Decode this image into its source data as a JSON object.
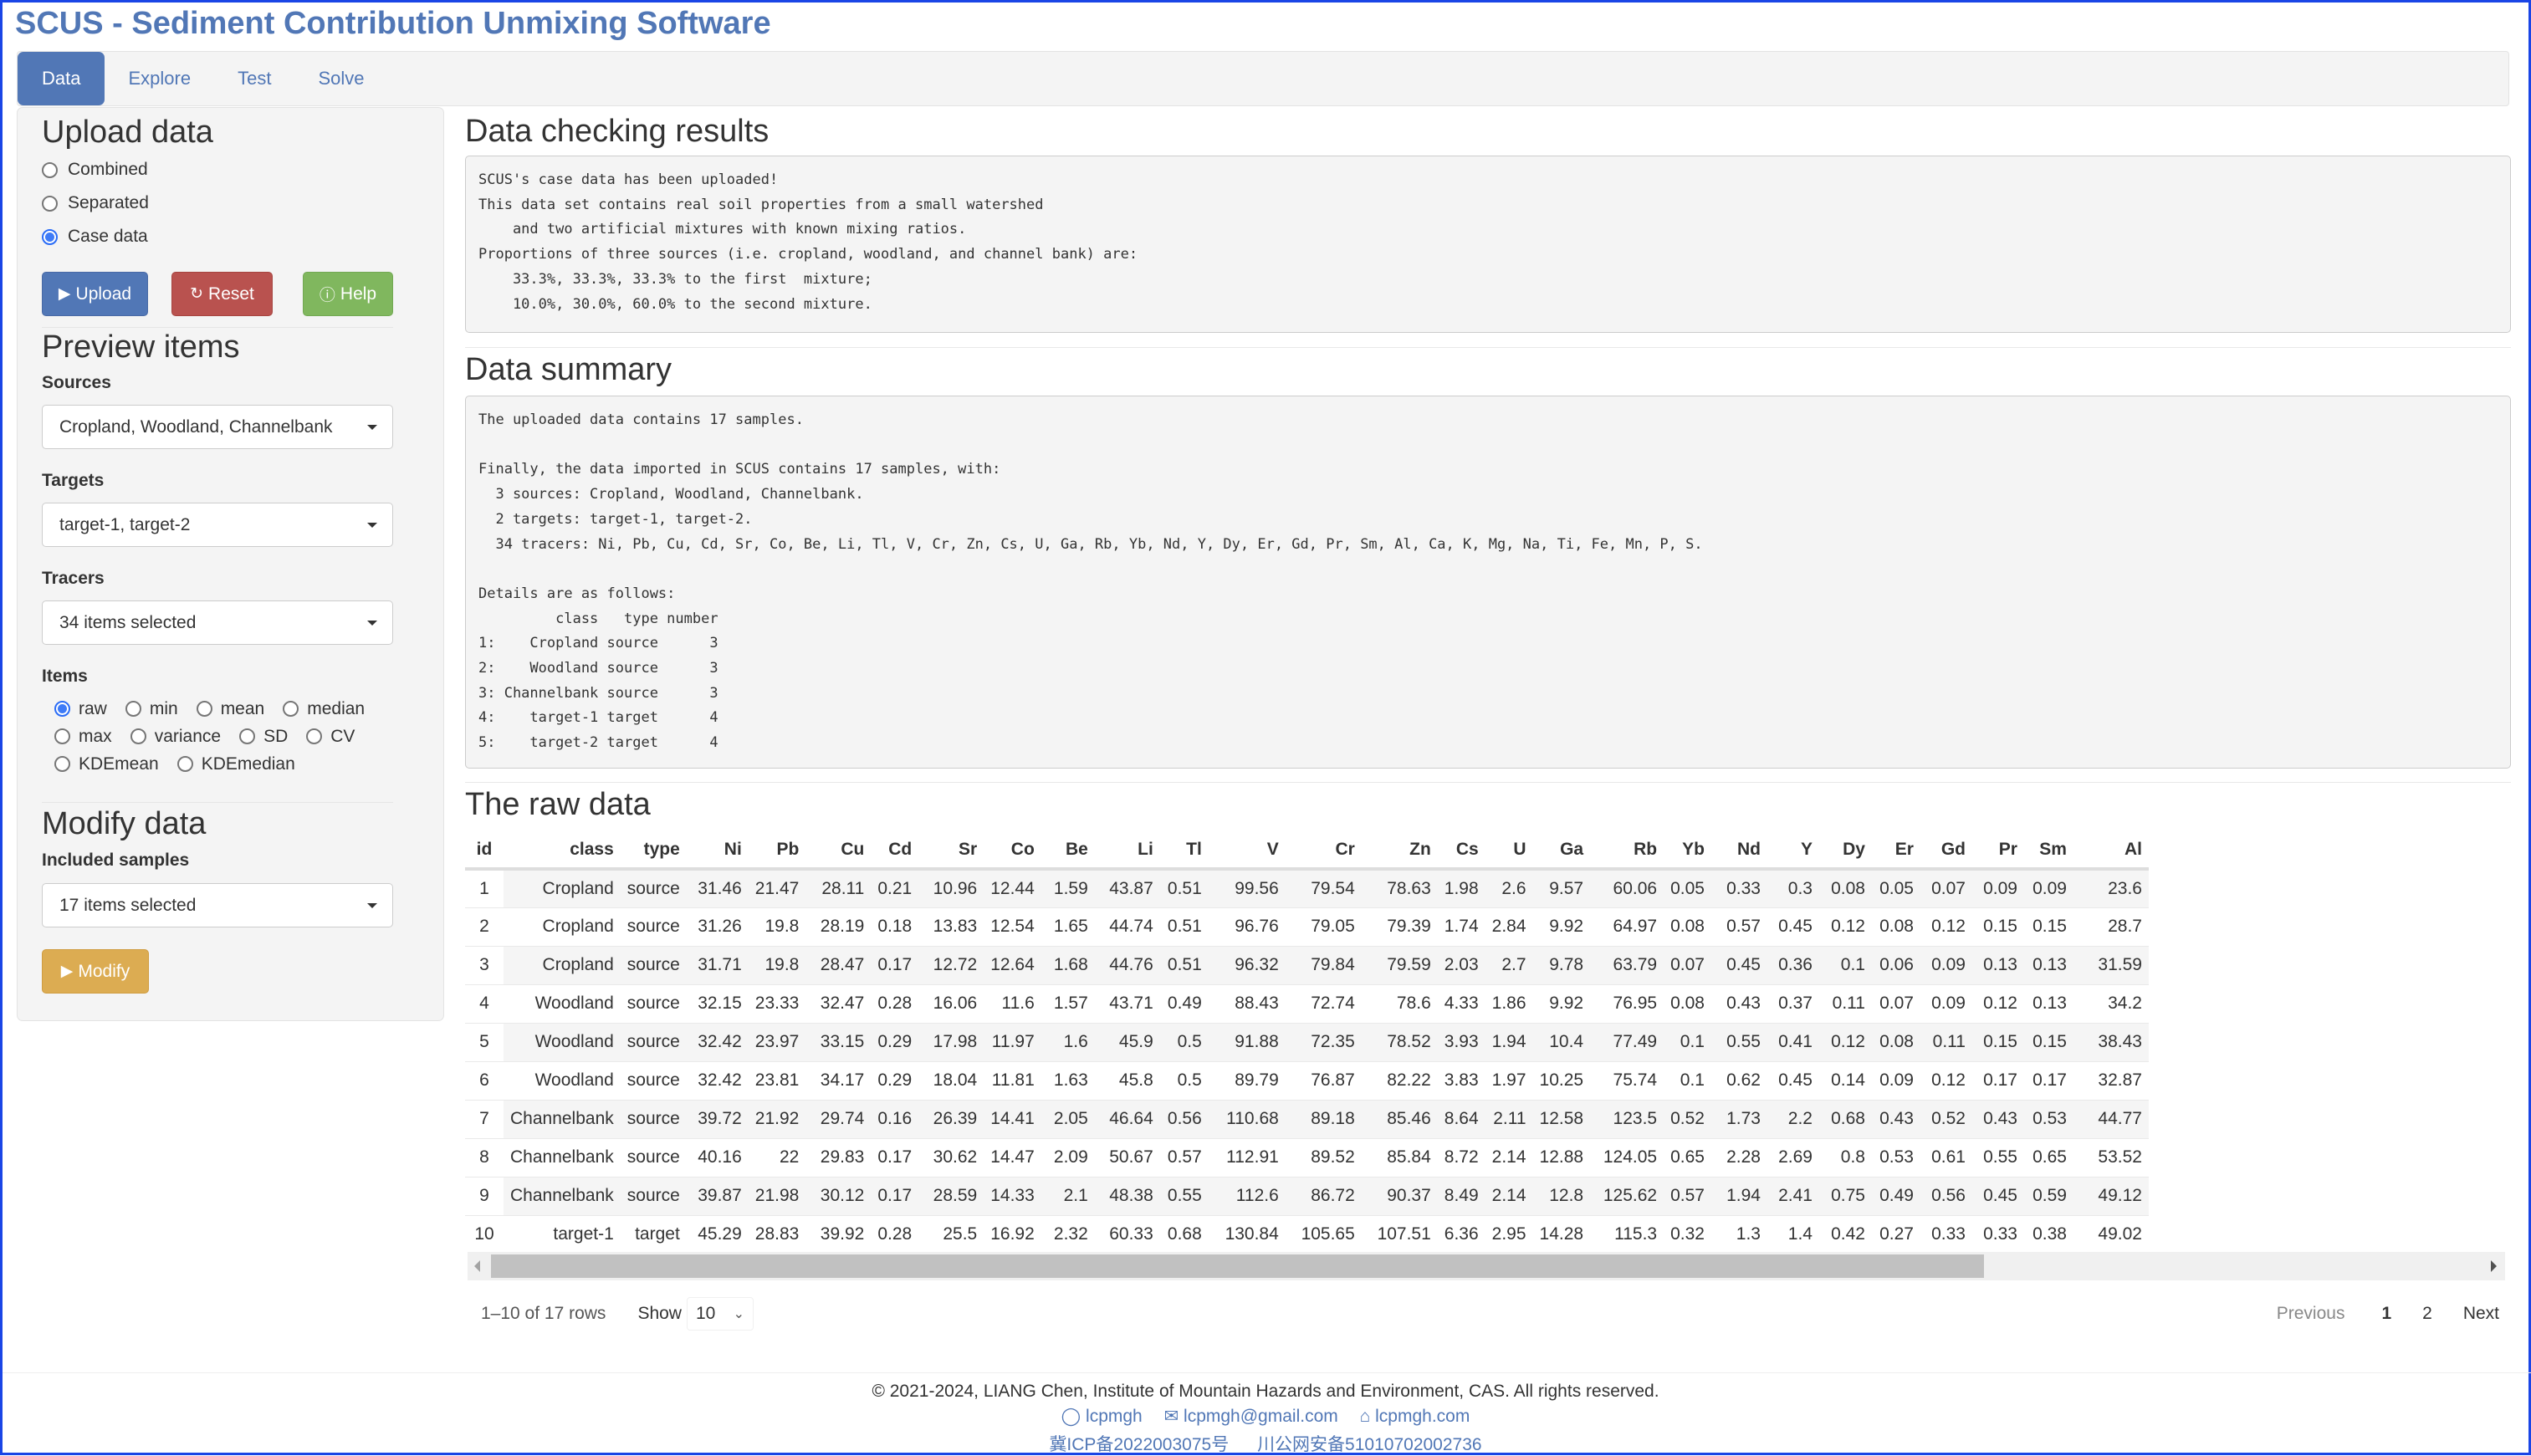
{
  "app": {
    "title": "SCUS - Sediment Contribution Unmixing Software"
  },
  "nav": {
    "tabs": [
      {
        "label": "Data",
        "active": true
      },
      {
        "label": "Explore",
        "active": false
      },
      {
        "label": "Test",
        "active": false
      },
      {
        "label": "Solve",
        "active": false
      }
    ]
  },
  "sidebar": {
    "upload": {
      "heading": "Upload data",
      "options": [
        {
          "label": "Combined",
          "checked": false
        },
        {
          "label": "Separated",
          "checked": false
        },
        {
          "label": "Case data",
          "checked": true
        }
      ],
      "buttons": {
        "upload": "Upload",
        "reset": "Reset",
        "help": "Help"
      }
    },
    "preview": {
      "heading": "Preview items",
      "sources_label": "Sources",
      "sources_value": "Cropland, Woodland, Channelbank",
      "targets_label": "Targets",
      "targets_value": "target-1, target-2",
      "tracers_label": "Tracers",
      "tracers_value": "34 items selected",
      "items_label": "Items",
      "items": [
        {
          "label": "raw",
          "checked": true
        },
        {
          "label": "min",
          "checked": false
        },
        {
          "label": "mean",
          "checked": false
        },
        {
          "label": "median",
          "checked": false
        },
        {
          "label": "max",
          "checked": false
        },
        {
          "label": "variance",
          "checked": false
        },
        {
          "label": "SD",
          "checked": false
        },
        {
          "label": "CV",
          "checked": false
        },
        {
          "label": "KDEmean",
          "checked": false
        },
        {
          "label": "KDEmedian",
          "checked": false
        }
      ]
    },
    "modify": {
      "heading": "Modify data",
      "samples_label": "Included samples",
      "samples_value": "17 items selected",
      "button": "Modify"
    }
  },
  "main": {
    "checking": {
      "heading": "Data checking results",
      "text": "SCUS's case data has been uploaded!\nThis data set contains real soil properties from a small watershed\n    and two artificial mixtures with known mixing ratios.\nProportions of three sources (i.e. cropland, woodland, and channel bank) are:\n    33.3%, 33.3%, 33.3% to the first  mixture;\n    10.0%, 30.0%, 60.0% to the second mixture."
    },
    "summary": {
      "heading": "Data summary",
      "text": "The uploaded data contains 17 samples.\n\nFinally, the data imported in SCUS contains 17 samples, with:\n  3 sources: Cropland, Woodland, Channelbank.\n  2 targets: target-1, target-2.\n  34 tracers: Ni, Pb, Cu, Cd, Sr, Co, Be, Li, Tl, V, Cr, Zn, Cs, U, Ga, Rb, Yb, Nd, Y, Dy, Er, Gd, Pr, Sm, Al, Ca, K, Mg, Na, Ti, Fe, Mn, P, S.\n\nDetails are as follows:\n         class   type number\n1:    Cropland source      3\n2:    Woodland source      3\n3: Channelbank source      3\n4:    target-1 target      4\n5:    target-2 target      4"
    },
    "raw": {
      "heading": "The raw data",
      "columns": [
        "id",
        "class",
        "type",
        "Ni",
        "Pb",
        "Cu",
        "Cd",
        "Sr",
        "Co",
        "Be",
        "Li",
        "Tl",
        "V",
        "Cr",
        "Zn",
        "Cs",
        "U",
        "Ga",
        "Rb",
        "Yb",
        "Nd",
        "Y",
        "Dy",
        "Er",
        "Gd",
        "Pr",
        "Sm",
        "Al"
      ],
      "rows": [
        [
          "1",
          "Cropland",
          "source",
          "31.46",
          "21.47",
          "28.11",
          "0.21",
          "10.96",
          "12.44",
          "1.59",
          "43.87",
          "0.51",
          "99.56",
          "79.54",
          "78.63",
          "1.98",
          "2.6",
          "9.57",
          "60.06",
          "0.05",
          "0.33",
          "0.3",
          "0.08",
          "0.05",
          "0.07",
          "0.09",
          "0.09",
          "23.6"
        ],
        [
          "2",
          "Cropland",
          "source",
          "31.26",
          "19.8",
          "28.19",
          "0.18",
          "13.83",
          "12.54",
          "1.65",
          "44.74",
          "0.51",
          "96.76",
          "79.05",
          "79.39",
          "1.74",
          "2.84",
          "9.92",
          "64.97",
          "0.08",
          "0.57",
          "0.45",
          "0.12",
          "0.08",
          "0.12",
          "0.15",
          "0.15",
          "28.7"
        ],
        [
          "3",
          "Cropland",
          "source",
          "31.71",
          "19.8",
          "28.47",
          "0.17",
          "12.72",
          "12.64",
          "1.68",
          "44.76",
          "0.51",
          "96.32",
          "79.84",
          "79.59",
          "2.03",
          "2.7",
          "9.78",
          "63.79",
          "0.07",
          "0.45",
          "0.36",
          "0.1",
          "0.06",
          "0.09",
          "0.13",
          "0.13",
          "31.59"
        ],
        [
          "4",
          "Woodland",
          "source",
          "32.15",
          "23.33",
          "32.47",
          "0.28",
          "16.06",
          "11.6",
          "1.57",
          "43.71",
          "0.49",
          "88.43",
          "72.74",
          "78.6",
          "4.33",
          "1.86",
          "9.92",
          "76.95",
          "0.08",
          "0.43",
          "0.37",
          "0.11",
          "0.07",
          "0.09",
          "0.12",
          "0.13",
          "34.2"
        ],
        [
          "5",
          "Woodland",
          "source",
          "32.42",
          "23.97",
          "33.15",
          "0.29",
          "17.98",
          "11.97",
          "1.6",
          "45.9",
          "0.5",
          "91.88",
          "72.35",
          "78.52",
          "3.93",
          "1.94",
          "10.4",
          "77.49",
          "0.1",
          "0.55",
          "0.41",
          "0.12",
          "0.08",
          "0.11",
          "0.15",
          "0.15",
          "38.43"
        ],
        [
          "6",
          "Woodland",
          "source",
          "32.42",
          "23.81",
          "34.17",
          "0.29",
          "18.04",
          "11.81",
          "1.63",
          "45.8",
          "0.5",
          "89.79",
          "76.87",
          "82.22",
          "3.83",
          "1.97",
          "10.25",
          "75.74",
          "0.1",
          "0.62",
          "0.45",
          "0.14",
          "0.09",
          "0.12",
          "0.17",
          "0.17",
          "32.87"
        ],
        [
          "7",
          "Channelbank",
          "source",
          "39.72",
          "21.92",
          "29.74",
          "0.16",
          "26.39",
          "14.41",
          "2.05",
          "46.64",
          "0.56",
          "110.68",
          "89.18",
          "85.46",
          "8.64",
          "2.11",
          "12.58",
          "123.5",
          "0.52",
          "1.73",
          "2.2",
          "0.68",
          "0.43",
          "0.52",
          "0.43",
          "0.53",
          "44.77"
        ],
        [
          "8",
          "Channelbank",
          "source",
          "40.16",
          "22",
          "29.83",
          "0.17",
          "30.62",
          "14.47",
          "2.09",
          "50.67",
          "0.57",
          "112.91",
          "89.52",
          "85.84",
          "8.72",
          "2.14",
          "12.88",
          "124.05",
          "0.65",
          "2.28",
          "2.69",
          "0.8",
          "0.53",
          "0.61",
          "0.55",
          "0.65",
          "53.52"
        ],
        [
          "9",
          "Channelbank",
          "source",
          "39.87",
          "21.98",
          "30.12",
          "0.17",
          "28.59",
          "14.33",
          "2.1",
          "48.38",
          "0.55",
          "112.6",
          "86.72",
          "90.37",
          "8.49",
          "2.14",
          "12.8",
          "125.62",
          "0.57",
          "1.94",
          "2.41",
          "0.75",
          "0.49",
          "0.56",
          "0.45",
          "0.59",
          "49.12"
        ],
        [
          "10",
          "target-1",
          "target",
          "45.29",
          "28.83",
          "39.92",
          "0.28",
          "25.5",
          "16.92",
          "2.32",
          "60.33",
          "0.68",
          "130.84",
          "105.65",
          "107.51",
          "6.36",
          "2.95",
          "14.28",
          "115.3",
          "0.32",
          "1.3",
          "1.4",
          "0.42",
          "0.27",
          "0.33",
          "0.33",
          "0.38",
          "49.02"
        ]
      ],
      "scroll_fraction_visible": 0.75,
      "scroll_position": 0,
      "row_info": "1–10 of 17 rows",
      "show_label": "Show",
      "page_size": "10",
      "pager": {
        "previous": "Previous",
        "pages": [
          "1",
          "2"
        ],
        "current": "1",
        "next": "Next"
      }
    }
  },
  "footer": {
    "copyright": "© 2021-2024, LIANG Chen, Institute of Mountain Hazards and Environment, CAS. All rights reserved.",
    "links": [
      {
        "icon": "github-icon",
        "label": "lcpmgh"
      },
      {
        "icon": "mail-icon",
        "label": "lcpmgh@gmail.com"
      },
      {
        "icon": "home-icon",
        "label": "lcpmgh.com"
      }
    ],
    "icp": [
      "冀ICP备2022003075号",
      "川公网安备51010702002736"
    ]
  },
  "colors": {
    "brand": "#5177b6",
    "danger": "#b9524f",
    "success": "#80b75e",
    "warning": "#dcac52"
  }
}
